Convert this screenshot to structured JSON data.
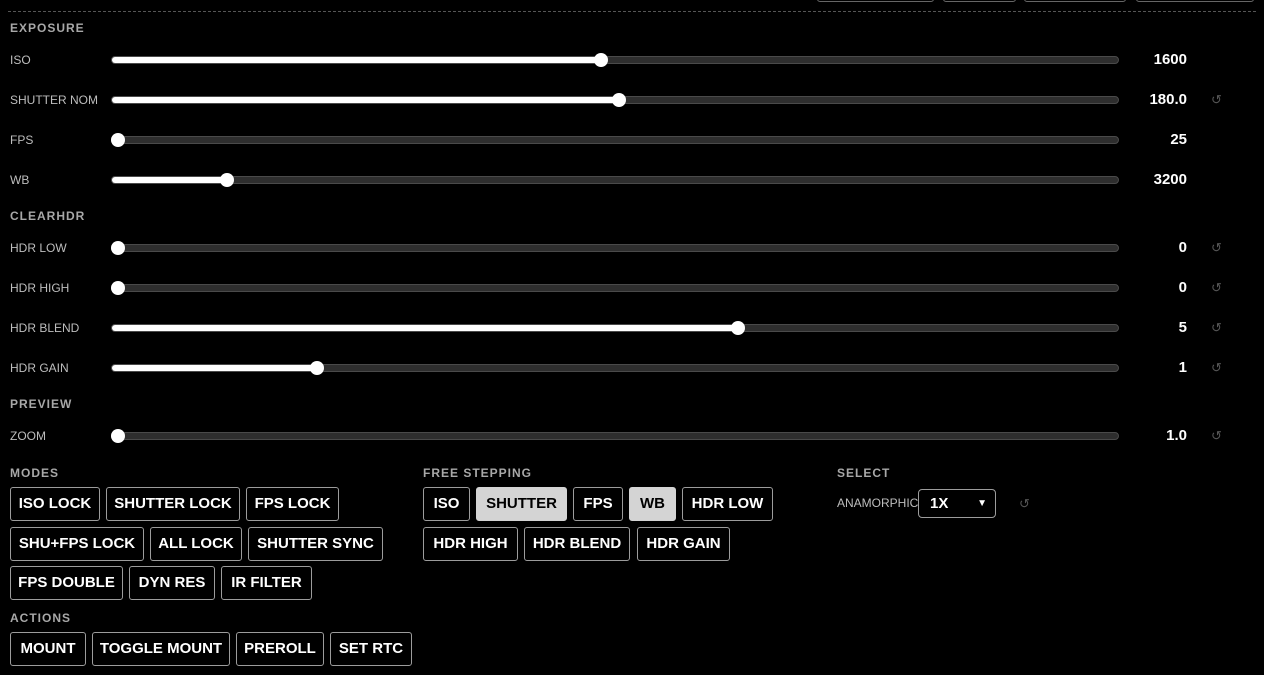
{
  "sections": {
    "exposure": "EXPOSURE",
    "clearhdr": "CLEARHDR",
    "preview": "PREVIEW",
    "modes": "MODES",
    "free_stepping": "FREE STEPPING",
    "select": "SELECT",
    "actions": "ACTIONS"
  },
  "sliders": {
    "iso": {
      "label": "ISO",
      "value": "1600",
      "fraction": 0.486
    },
    "shutter_nom": {
      "label": "SHUTTER NOM",
      "value": "180.0",
      "fraction": 0.504
    },
    "fps": {
      "label": "FPS",
      "value": "25",
      "fraction": 0.006
    },
    "wb": {
      "label": "WB",
      "value": "3200",
      "fraction": 0.114
    },
    "hdr_low": {
      "label": "HDR LOW",
      "value": "0",
      "fraction": 0.006
    },
    "hdr_high": {
      "label": "HDR HIGH",
      "value": "0",
      "fraction": 0.006
    },
    "hdr_blend": {
      "label": "HDR BLEND",
      "value": "5",
      "fraction": 0.622
    },
    "hdr_gain": {
      "label": "HDR GAIN",
      "value": "1",
      "fraction": 0.204
    },
    "zoom": {
      "label": "ZOOM",
      "value": "1.0",
      "fraction": 0.006
    }
  },
  "reset_glyph": "↺",
  "modes": {
    "iso_lock": "ISO LOCK",
    "shutter_lock": "SHUTTER LOCK",
    "fps_lock": "FPS LOCK",
    "shu_fps_lock": "SHU+FPS LOCK",
    "all_lock": "ALL LOCK",
    "shutter_sync": "SHUTTER SYNC",
    "fps_double": "FPS DOUBLE",
    "dyn_res": "DYN RES",
    "ir_filter": "IR FILTER"
  },
  "free_stepping": {
    "iso": "ISO",
    "shutter": "SHUTTER",
    "fps": "FPS",
    "wb": "WB",
    "hdr_low": "HDR LOW",
    "hdr_high": "HDR HIGH",
    "hdr_blend": "HDR BLEND",
    "hdr_gain": "HDR GAIN"
  },
  "free_stepping_active": [
    "shutter",
    "wb"
  ],
  "select": {
    "anamorphic_label": "ANAMORPHIC",
    "anamorphic_value": "1X"
  },
  "actions": {
    "mount": "MOUNT",
    "toggle_mount": "TOGGLE MOUNT",
    "preroll": "PREROLL",
    "set_rtc": "SET RTC"
  }
}
